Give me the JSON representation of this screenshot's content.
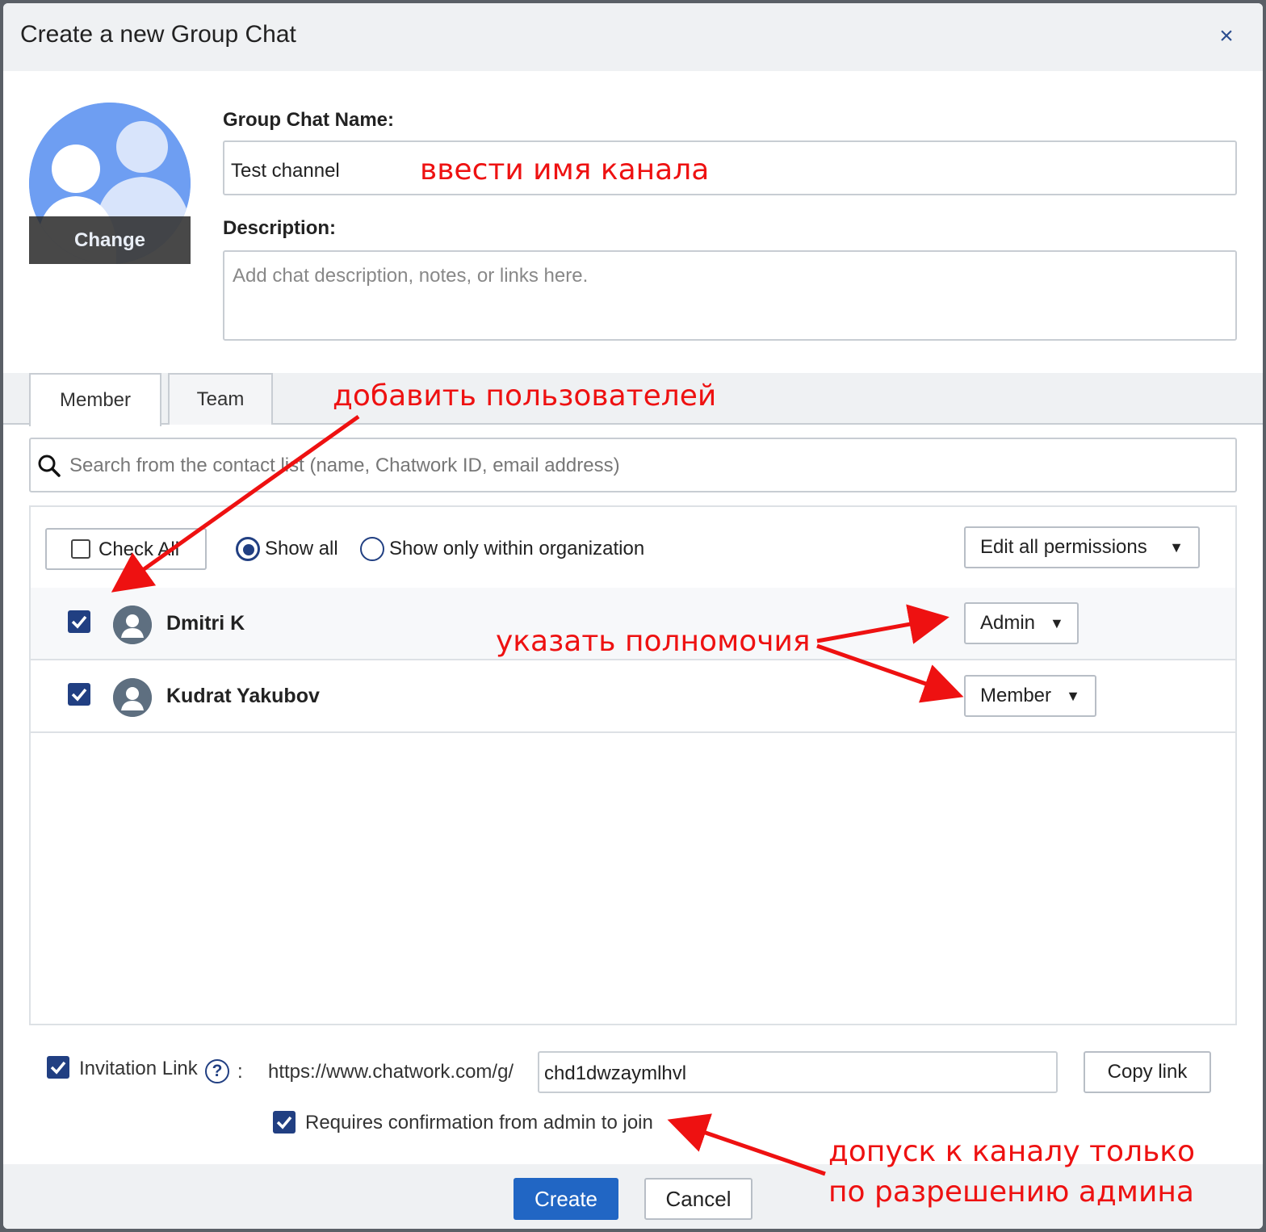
{
  "dialog": {
    "title": "Create a new Group Chat",
    "close_icon": "×"
  },
  "avatar": {
    "change_label": "Change"
  },
  "form": {
    "name_label": "Group Chat Name:",
    "name_value": "Test channel",
    "description_label": "Description:",
    "description_placeholder": "Add chat description, notes, or links here."
  },
  "tabs": [
    {
      "label": "Member",
      "active": true
    },
    {
      "label": "Team",
      "active": false
    }
  ],
  "search": {
    "placeholder": "Search from the contact list (name, Chatwork ID, email address)"
  },
  "filters": {
    "check_all_label": "Check All",
    "show_all_label": "Show all",
    "show_all_selected": true,
    "show_org_label": "Show only within organization",
    "show_org_selected": false,
    "edit_permissions_label": "Edit all permissions"
  },
  "members": [
    {
      "name": "Dmitri K",
      "checked": true,
      "role": "Admin"
    },
    {
      "name": "Kudrat Yakubov",
      "checked": true,
      "role": "Member"
    }
  ],
  "invitation": {
    "enabled": true,
    "label": "Invitation Link",
    "help_icon": "?",
    "colon": ":",
    "url_prefix": "https://www.chatwork.com/g/",
    "link_code": "chd1dwzaymlhvl",
    "copy_label": "Copy link",
    "requires_confirmation": true,
    "confirmation_label": "Requires confirmation from admin to join"
  },
  "footer": {
    "create_label": "Create",
    "cancel_label": "Cancel"
  },
  "annotations": {
    "enter_name": "ввести имя канала",
    "add_users": "добавить пользователей",
    "set_permissions": "указать полномочия",
    "admin_only_line1": "допуск к каналу только",
    "admin_only_line2": "по разрешению админа"
  },
  "colors": {
    "primary": "#2166c4",
    "checkbox": "#213f82",
    "annotation": "#ee1111",
    "avatar_bg": "#6e9ef2"
  }
}
